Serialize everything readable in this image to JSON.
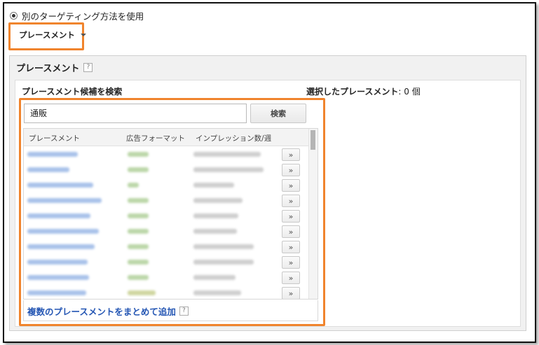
{
  "targeting": {
    "radio_label": "別のターゲティング方法を使用",
    "dropdown_label": "プレースメント"
  },
  "panel": {
    "title": "プレースメント",
    "help": "?",
    "search_heading": "プレースメント候補を検索",
    "selected_label": "選択したプレースメント",
    "selected_count": ": 0 個",
    "search_value": "通販",
    "search_button": "検索",
    "columns": [
      "プレースメント",
      "広告フォーマット",
      "インプレッション数/週"
    ],
    "add_glyph": "»",
    "bulk_add_link": "複数のプレースメントをまとめて追加",
    "bulk_help": "?"
  },
  "colors": {
    "highlight": "#f0842d",
    "link": "#2355b3"
  }
}
